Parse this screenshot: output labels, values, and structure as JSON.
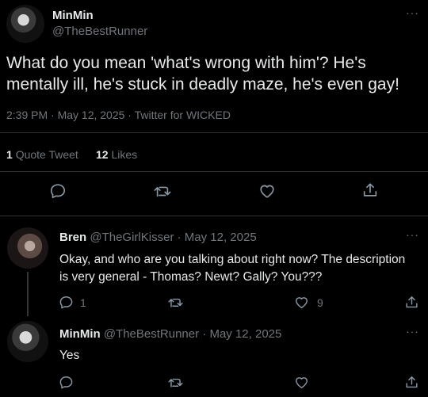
{
  "main_tweet": {
    "display_name": "MinMin",
    "handle": "@TheBestRunner",
    "text_line1": "What do you mean 'what's wrong with him'? He's",
    "text_line2": "mentally ill, he's stuck in deadly maze, he's even gay!",
    "meta": "2:39 PM · May 12, 2025 · Twitter for WICKED",
    "quote_count": "1",
    "quote_label": "Quote Tweet",
    "like_count": "12",
    "like_label": "Likes"
  },
  "reply1": {
    "display_name": "Bren",
    "handle": "@TheGirlKisser",
    "date": "· May 12, 2025",
    "text_line1": "Okay, and who are you talking about right now? The description",
    "text_line2": "is very general - Thomas? Newt? Gally? You???",
    "reply_count": "1",
    "like_count": "9"
  },
  "reply2": {
    "display_name": "MinMin",
    "handle": "@TheBestRunner",
    "date": "· May 12, 2025",
    "text": "Yes"
  },
  "more_glyph": "···",
  "icons": [
    "reply-icon",
    "retweet-icon",
    "like-icon",
    "share-icon",
    "more-icon"
  ],
  "colors": {
    "background": "#000000",
    "text": "#e7e9ea",
    "muted": "#71767b",
    "divider": "#2f3336"
  }
}
